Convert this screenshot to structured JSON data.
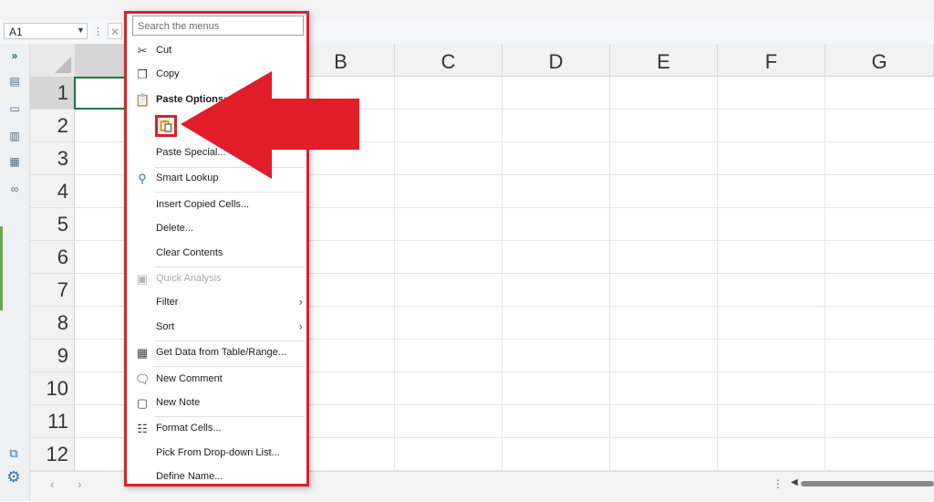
{
  "formula_bar": {
    "name_box": "A1",
    "cancel_glyph": "✕"
  },
  "columns": [
    {
      "id": "A",
      "label": ""
    },
    {
      "id": "B",
      "label": "B"
    },
    {
      "id": "C",
      "label": "C"
    },
    {
      "id": "D",
      "label": "D"
    },
    {
      "id": "E",
      "label": "E"
    },
    {
      "id": "F",
      "label": "F"
    },
    {
      "id": "G",
      "label": "G"
    }
  ],
  "rows": [
    "1",
    "2",
    "3",
    "4",
    "5",
    "6",
    "7",
    "8",
    "9",
    "10",
    "11",
    "12"
  ],
  "selected_cell": "A1",
  "context_menu": {
    "search_placeholder": "Search the menus",
    "items": {
      "cut": "Cut",
      "copy": "Copy",
      "paste_options": "Paste Options:",
      "paste_special": "Paste Special...",
      "smart_lookup": "Smart Lookup",
      "insert_copied_cells": "Insert Copied Cells...",
      "delete": "Delete...",
      "clear_contents": "Clear Contents",
      "quick_analysis": "Quick Analysis",
      "filter": "Filter",
      "sort": "Sort",
      "get_data": "Get Data from Table/Range...",
      "new_comment": "New Comment",
      "new_note": "New Note",
      "format_cells": "Format Cells...",
      "pick_from_list": "Pick From Drop-down List...",
      "define_name": "Define Name..."
    }
  },
  "colors": {
    "highlight": "#e11d2a",
    "selection_border": "#107c41",
    "paste_icon": "#d97706"
  }
}
